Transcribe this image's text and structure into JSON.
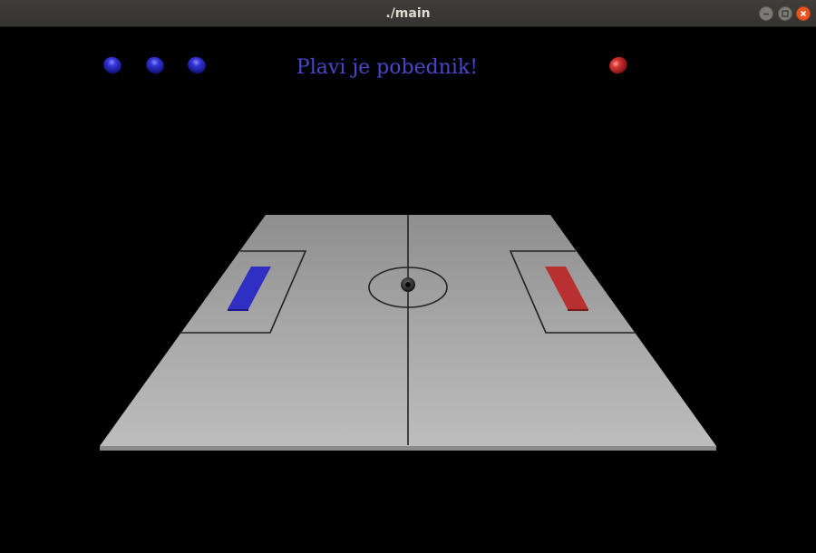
{
  "window": {
    "title": "./main"
  },
  "game": {
    "status_message": "Plavi je pobednik!",
    "blue_lives": 3,
    "red_lives": 1,
    "colors": {
      "blue_team": "#2f2fd0",
      "red_team": "#d03434",
      "message": "#4848c8",
      "field": "#b4b4b4",
      "lines": "#222222"
    }
  },
  "icons": {
    "minimize": "minimize-icon",
    "maximize": "maximize-icon",
    "close": "close-icon"
  }
}
